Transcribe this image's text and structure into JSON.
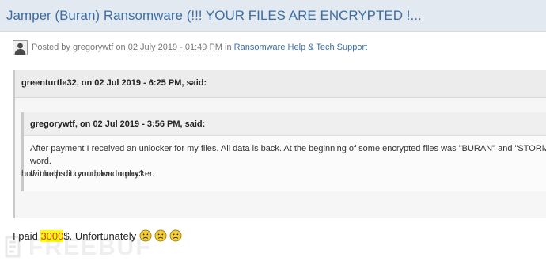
{
  "topic": {
    "title": "Jamper (Buran) Ransomware (!!! YOUR FILES ARE ENCRYPTED !..."
  },
  "post_meta": {
    "prefix": "Posted by",
    "author": "gregorywtf",
    "on": "on",
    "date": "02 July 2019 - 01:49 PM",
    "in": "in",
    "forum": "Ransomware Help & Tech Support"
  },
  "outer_quote": {
    "citation": "greenturtle32, on 02 Jul 2019 - 6:25 PM, said:",
    "reply": "how much did you have to pay?"
  },
  "inner_quote": {
    "citation": "gregorywtf, on 02 Jul 2019 - 3:56 PM, said:",
    "line1": "After payment I received an unlocker for my files. All data is back. At the beginning of some encrypted files was \"BURAN\" and \"STORM\" word.",
    "line2": "If it helps, I can upload unlocker."
  },
  "final": {
    "before": "I paid",
    "amount": "3000",
    "after": "$. Unfortunately",
    "emoji": [
      "sad-face",
      "sad-face",
      "sad-face"
    ]
  },
  "watermark": {
    "text": "FREEBUF"
  },
  "colors": {
    "link": "#3c6ea3",
    "highlight_bg": "#ffff00",
    "highlight_text": "#d43a00",
    "title_bar_bg": "#e3e9f0"
  }
}
